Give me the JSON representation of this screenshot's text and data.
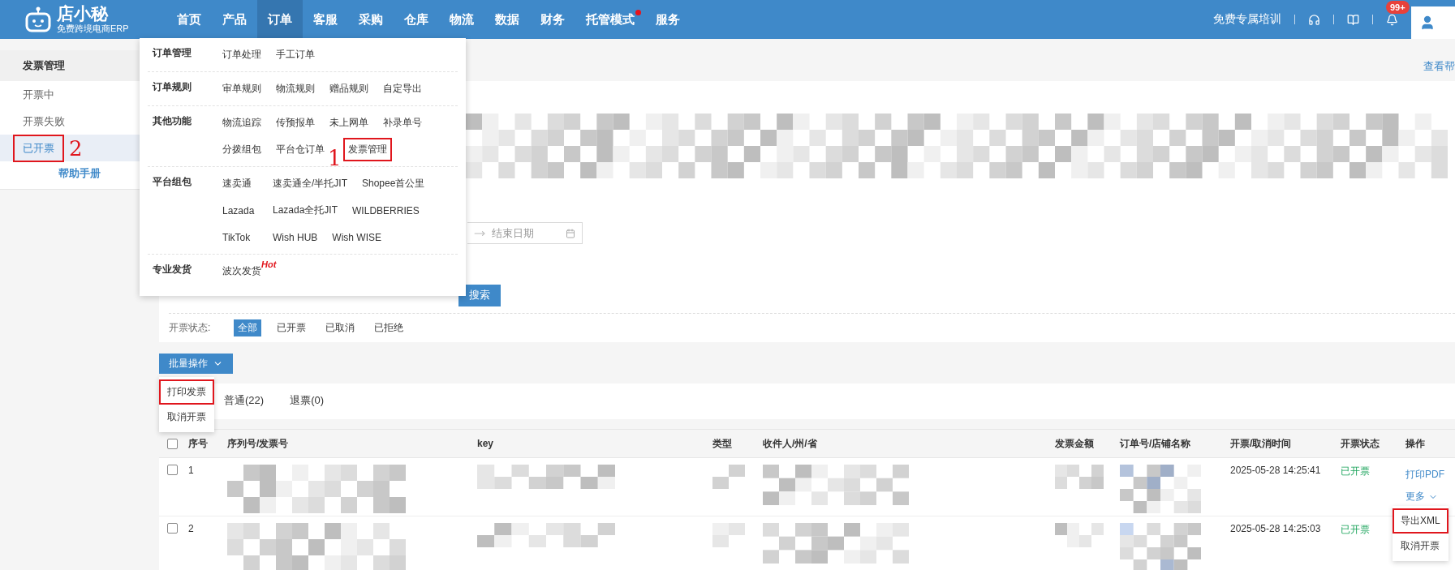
{
  "logo": {
    "name": "店小秘",
    "tagline": "免费跨境电商ERP"
  },
  "nav": [
    {
      "label": "首页",
      "selected": false,
      "dot": false
    },
    {
      "label": "产品",
      "selected": false,
      "dot": false
    },
    {
      "label": "订单",
      "selected": true,
      "dot": false
    },
    {
      "label": "客服",
      "selected": false,
      "dot": false
    },
    {
      "label": "采购",
      "selected": false,
      "dot": false
    },
    {
      "label": "仓库",
      "selected": false,
      "dot": false
    },
    {
      "label": "物流",
      "selected": false,
      "dot": false
    },
    {
      "label": "数据",
      "selected": false,
      "dot": false
    },
    {
      "label": "财务",
      "selected": false,
      "dot": false
    },
    {
      "label": "托管模式",
      "selected": false,
      "dot": true
    },
    {
      "label": "服务",
      "selected": false,
      "dot": false
    }
  ],
  "header_right": {
    "training": "免费专属培训",
    "badge": "99+"
  },
  "sidebar": {
    "title": "发票管理",
    "items": [
      {
        "label": "开票中",
        "selected": false,
        "highlighted": false
      },
      {
        "label": "开票失败",
        "selected": false,
        "highlighted": false
      },
      {
        "label": "已开票",
        "selected": true,
        "highlighted": true,
        "marker": "2"
      }
    ],
    "help": "帮助手册"
  },
  "help_link": "查看帮",
  "filters": {
    "date_end_placeholder": "结束日期",
    "search_button": "搜索",
    "status_label": "开票状态:",
    "statuses": [
      {
        "label": "全部",
        "selected": true
      },
      {
        "label": "已开票",
        "selected": false
      },
      {
        "label": "已取消",
        "selected": false
      },
      {
        "label": "已拒绝",
        "selected": false
      }
    ]
  },
  "batch": {
    "label": "批量操作",
    "menu": [
      {
        "label": "打印发票",
        "highlighted": true
      },
      {
        "label": "取消开票",
        "highlighted": false
      }
    ]
  },
  "tabs": [
    {
      "label": "普通(22)",
      "selected": false
    },
    {
      "label": "退票(0)",
      "selected": false
    }
  ],
  "table": {
    "header_checked": false,
    "columns": [
      "序号",
      "序列号/发票号",
      "key",
      "类型",
      "收件人/州/省",
      "发票金额",
      "订单号/店铺名称",
      "开票/取消时间",
      "开票状态",
      "操作"
    ],
    "rows": [
      {
        "checked": false,
        "index": "1",
        "time": "2025-05-28 14:25:41",
        "status": "已开票",
        "actions": [
          "打印PDF",
          "更多"
        ]
      },
      {
        "checked": false,
        "index": "2",
        "time": "2025-05-28 14:25:03",
        "status": "已开票",
        "actions": []
      }
    ]
  },
  "row_menu": [
    {
      "label": "导出XML",
      "highlighted": true
    },
    {
      "label": "取消开票",
      "highlighted": false
    }
  ],
  "nav_menu": [
    {
      "title": "订单管理",
      "rows": [
        [
          {
            "label": "订单处理"
          },
          {
            "label": "手工订单"
          }
        ]
      ]
    },
    {
      "title": "订单规则",
      "rows": [
        [
          {
            "label": "审单规则"
          },
          {
            "label": "物流规则"
          },
          {
            "label": "赠品规则"
          },
          {
            "label": "自定导出"
          }
        ]
      ]
    },
    {
      "title": "其他功能",
      "rows": [
        [
          {
            "label": "物流追踪"
          },
          {
            "label": "传预报单"
          },
          {
            "label": "未上网单"
          },
          {
            "label": "补录单号"
          }
        ],
        [
          {
            "label": "分拨组包"
          },
          {
            "label": "平台仓订单",
            "marker": "1"
          },
          {
            "label": "发票管理",
            "highlighted": true
          }
        ]
      ]
    },
    {
      "title": "平台组包",
      "rows": [
        [
          {
            "label": "速卖通"
          },
          {
            "label": "速卖通全/半托JIT"
          },
          {
            "label": "Shopee首公里"
          }
        ],
        [
          {
            "label": "Lazada"
          },
          {
            "label": "Lazada全托JIT"
          },
          {
            "label": "WILDBERRIES"
          }
        ],
        [
          {
            "label": "TikTok"
          },
          {
            "label": "Wish HUB"
          },
          {
            "label": "Wish WISE"
          }
        ]
      ]
    },
    {
      "title": "专业发货",
      "rows": [
        [
          {
            "label": "波次发货",
            "tag": "Hot"
          }
        ]
      ]
    }
  ]
}
